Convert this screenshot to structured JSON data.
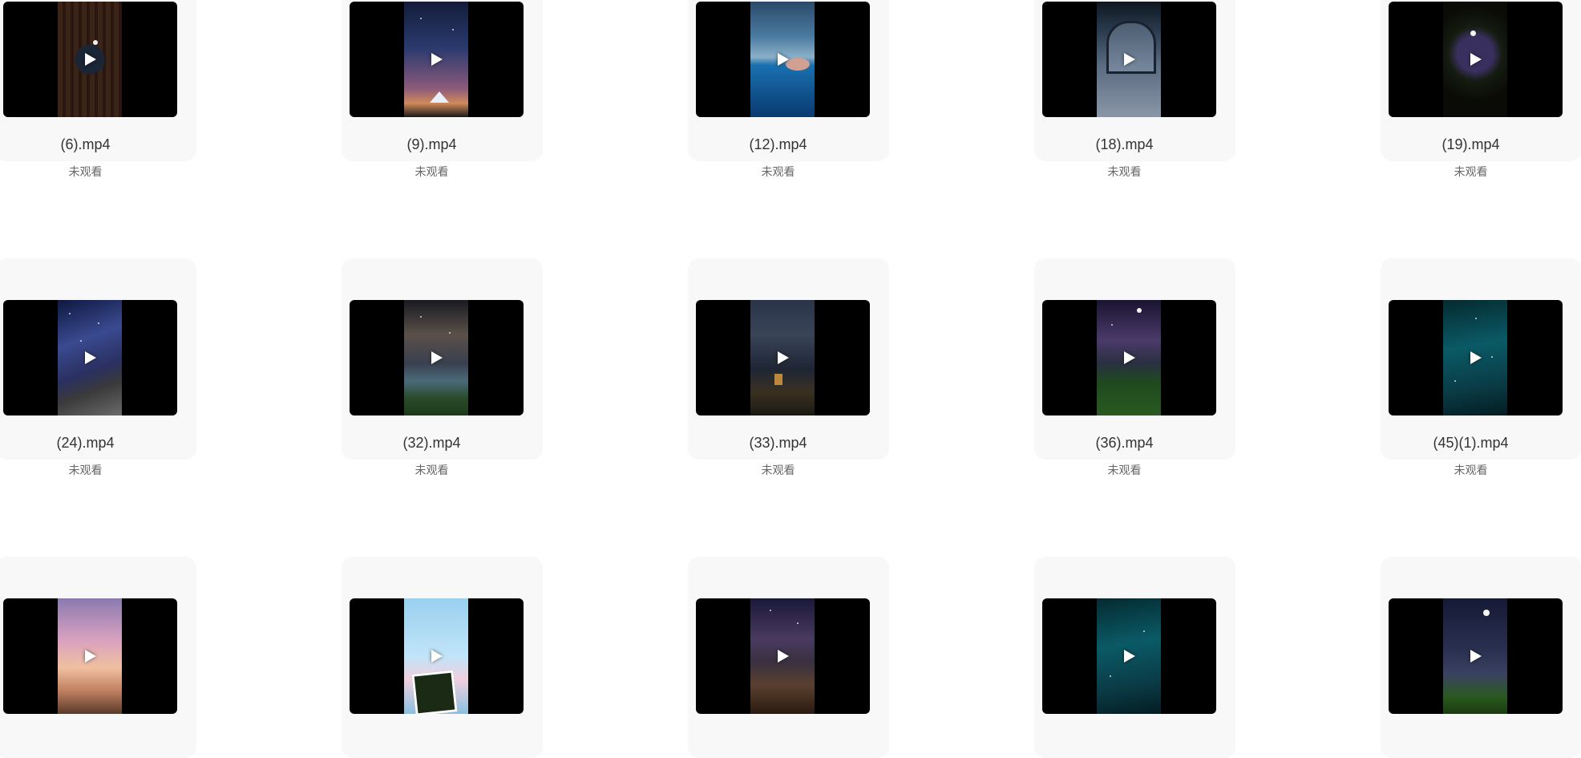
{
  "videos": [
    {
      "name": "(6).mp4",
      "status": "未观看"
    },
    {
      "name": "(9).mp4",
      "status": "未观看"
    },
    {
      "name": "(12).mp4",
      "status": "未观看"
    },
    {
      "name": "(18).mp4",
      "status": "未观看"
    },
    {
      "name": "(19).mp4",
      "status": "未观看"
    },
    {
      "name": "(24).mp4",
      "status": "未观看"
    },
    {
      "name": "(32).mp4",
      "status": "未观看"
    },
    {
      "name": "(33).mp4",
      "status": "未观看"
    },
    {
      "name": "(36).mp4",
      "status": "未观看"
    },
    {
      "name": "(45)(1).mp4",
      "status": "未观看"
    },
    {
      "name": "",
      "status": ""
    },
    {
      "name": "",
      "status": ""
    },
    {
      "name": "",
      "status": ""
    },
    {
      "name": "",
      "status": ""
    },
    {
      "name": "",
      "status": ""
    }
  ],
  "icons": {
    "play": "play-icon"
  }
}
